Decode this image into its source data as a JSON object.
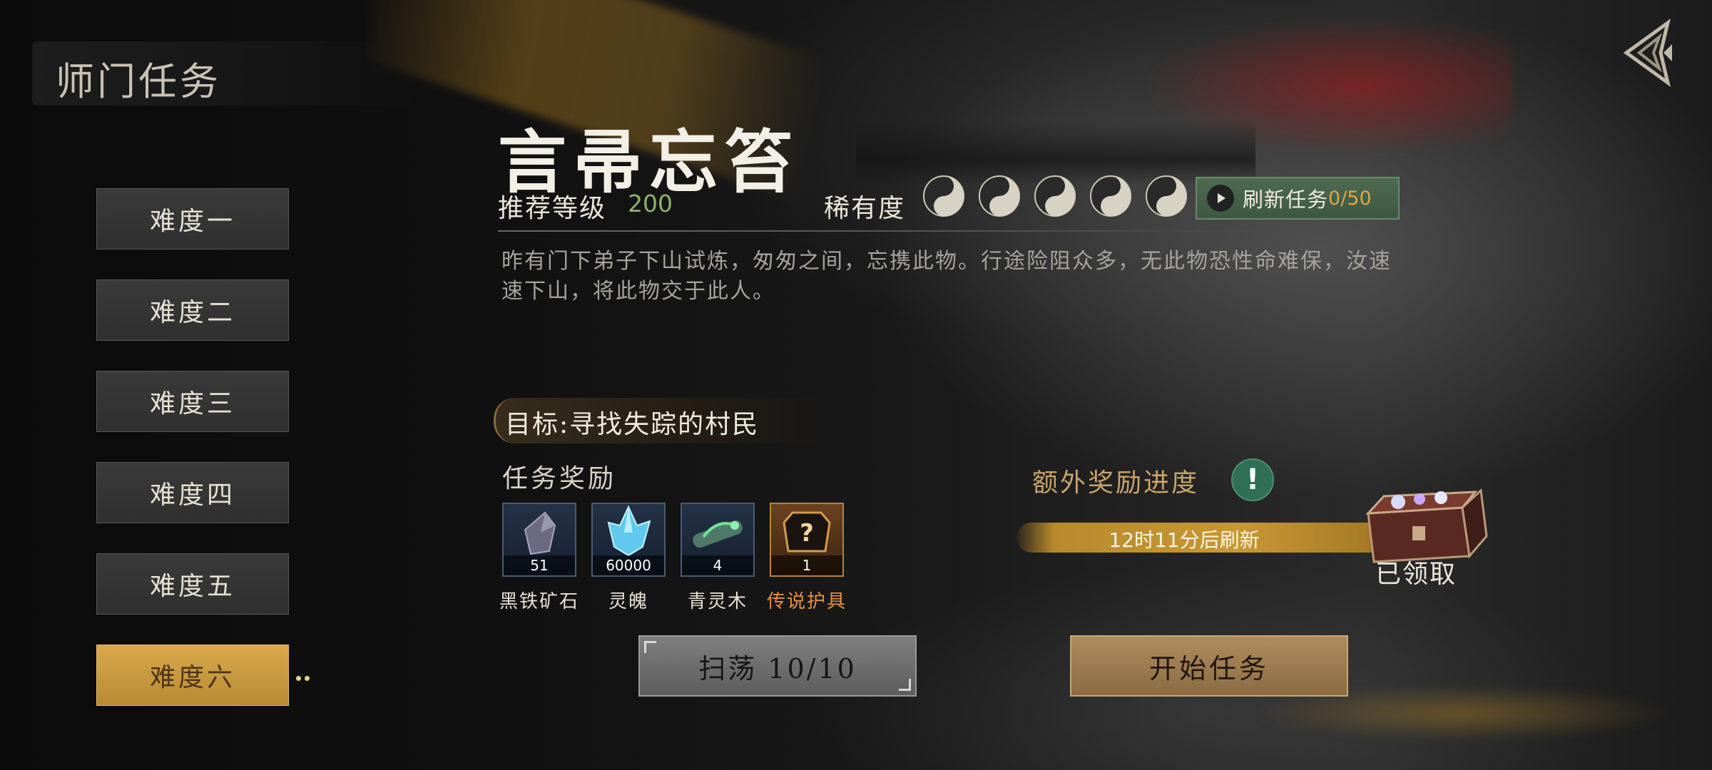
{
  "header": {
    "title": "师门任务"
  },
  "difficulties": [
    {
      "label": "难度一",
      "active": false
    },
    {
      "label": "难度二",
      "active": false
    },
    {
      "label": "难度三",
      "active": false
    },
    {
      "label": "难度四",
      "active": false
    },
    {
      "label": "难度五",
      "active": false
    },
    {
      "label": "难度六",
      "active": true
    }
  ],
  "quest": {
    "title": "言帚忘笞",
    "level_label": "推荐等级",
    "level_value": "200",
    "rarity_label": "稀有度",
    "rarity_count": 5,
    "refresh_label": "刷新任务",
    "refresh_count": "0/50",
    "description": "昨有门下弟子下山试炼，匆匆之间，忘携此物。行途险阻众多，无此物恐性命难保，汝速速下山，将此物交于此人。",
    "objective": "目标:寻找失踪的村民"
  },
  "rewards": {
    "title": "任务奖励",
    "items": [
      {
        "name": "黑铁矿石",
        "count": "51",
        "icon": "ore-crystal-icon"
      },
      {
        "name": "灵魄",
        "count": "60000",
        "icon": "spirit-crystal-icon"
      },
      {
        "name": "青灵木",
        "count": "4",
        "icon": "green-wood-icon"
      },
      {
        "name": "传说护具",
        "count": "1",
        "icon": "mystery-armor-icon"
      }
    ]
  },
  "extra": {
    "title": "额外奖励进度",
    "refresh_text": "12时11分后刷新",
    "claimed_label": "已领取"
  },
  "actions": {
    "sweep_label": "扫荡 10/10",
    "start_label": "开始任务"
  },
  "colors": {
    "active_tab": "#c99a3e",
    "level_value": "#8fb36a",
    "refresh_count": "#e0a44a",
    "legend_item": "#e7913a",
    "extra_title": "#c8a46a",
    "badge": "#2f6f55"
  }
}
